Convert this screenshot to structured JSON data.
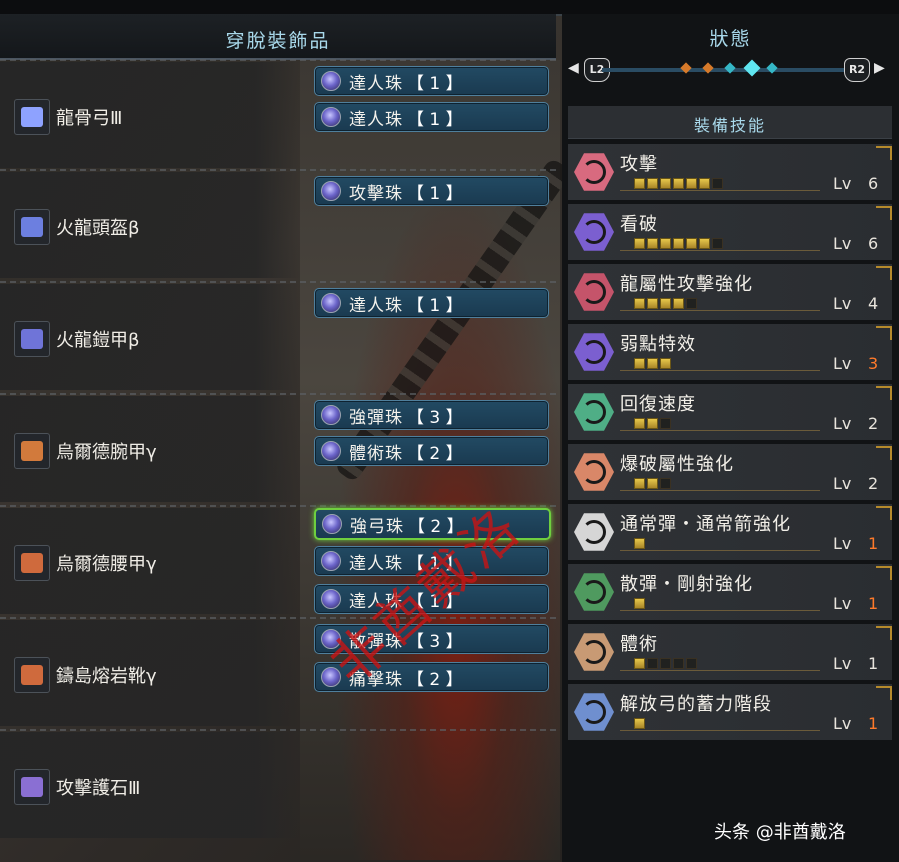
{
  "left_panel": {
    "title": "穿脫裝飾品",
    "equipment": [
      {
        "name": "龍骨弓Ⅲ",
        "icon": "bow-icon",
        "decorations": [
          {
            "name": "達人珠",
            "level": "【 1 】"
          },
          {
            "name": "達人珠",
            "level": "【 1 】"
          }
        ]
      },
      {
        "name": "火龍頭盔β",
        "icon": "helmet-icon",
        "decorations": [
          {
            "name": "攻擊珠",
            "level": "【 1 】"
          }
        ]
      },
      {
        "name": "火龍鎧甲β",
        "icon": "chest-armor-icon",
        "decorations": [
          {
            "name": "達人珠",
            "level": "【 1 】"
          }
        ]
      },
      {
        "name": "烏爾德腕甲γ",
        "icon": "arm-armor-icon",
        "decorations": [
          {
            "name": "強彈珠",
            "level": "【 3 】"
          },
          {
            "name": "體術珠",
            "level": "【 2 】"
          }
        ]
      },
      {
        "name": "烏爾德腰甲γ",
        "icon": "waist-armor-icon",
        "decorations": [
          {
            "name": "強弓珠",
            "level": "【 2 】"
          },
          {
            "name": "達人珠",
            "level": "【 1 】"
          },
          {
            "name": "達人珠",
            "level": "【 1 】"
          }
        ]
      },
      {
        "name": "鑄島熔岩靴γ",
        "icon": "leg-armor-icon",
        "decorations": [
          {
            "name": "散彈珠",
            "level": "【 3 】"
          },
          {
            "name": "痛擊珠",
            "level": "【 2 】"
          }
        ]
      },
      {
        "name": "攻擊護石Ⅲ",
        "icon": "charm-icon",
        "decorations": []
      }
    ]
  },
  "right_panel": {
    "title": "狀態",
    "nav_left": "L2",
    "nav_right": "R2",
    "skills_title": "裝備技能",
    "skills": [
      {
        "name": "攻擊",
        "lv_label": "Lv",
        "level": "6",
        "filled": 6,
        "max": 7,
        "color": "#d86a7f",
        "max_color": "normal"
      },
      {
        "name": "看破",
        "lv_label": "Lv",
        "level": "6",
        "filled": 6,
        "max": 7,
        "color": "#7b5fd0",
        "max_color": "normal"
      },
      {
        "name": "龍屬性攻擊強化",
        "lv_label": "Lv",
        "level": "4",
        "filled": 4,
        "max": 5,
        "color": "#c5546a",
        "max_color": "normal"
      },
      {
        "name": "弱點特效",
        "lv_label": "Lv",
        "level": "3",
        "filled": 3,
        "max": 3,
        "color": "#7b5fd0",
        "max_color": "orange"
      },
      {
        "name": "回復速度",
        "lv_label": "Lv",
        "level": "2",
        "filled": 2,
        "max": 3,
        "color": "#4fae86",
        "max_color": "normal"
      },
      {
        "name": "爆破屬性強化",
        "lv_label": "Lv",
        "level": "2",
        "filled": 2,
        "max": 3,
        "color": "#d98768",
        "max_color": "normal"
      },
      {
        "name": "通常彈・通常箭強化",
        "lv_label": "Lv",
        "level": "1",
        "filled": 1,
        "max": 1,
        "color": "#d6d6d6",
        "max_color": "orange"
      },
      {
        "name": "散彈・剛射強化",
        "lv_label": "Lv",
        "level": "1",
        "filled": 1,
        "max": 1,
        "color": "#4f9a5f",
        "max_color": "orange"
      },
      {
        "name": "體術",
        "lv_label": "Lv",
        "level": "1",
        "filled": 1,
        "max": 5,
        "color": "#c89a74",
        "max_color": "normal"
      },
      {
        "name": "解放弓的蓄力階段",
        "lv_label": "Lv",
        "level": "1",
        "filled": 1,
        "max": 1,
        "color": "#6f8fcf",
        "max_color": "orange"
      }
    ]
  },
  "watermark": "非酋戴洛",
  "credit": "头条 @非酋戴洛",
  "colors": {
    "accent_title": "#a8d8ea",
    "gold": "#e7c84b",
    "max_orange": "#ff7a2a",
    "selected_border": "#6fcf3f"
  }
}
